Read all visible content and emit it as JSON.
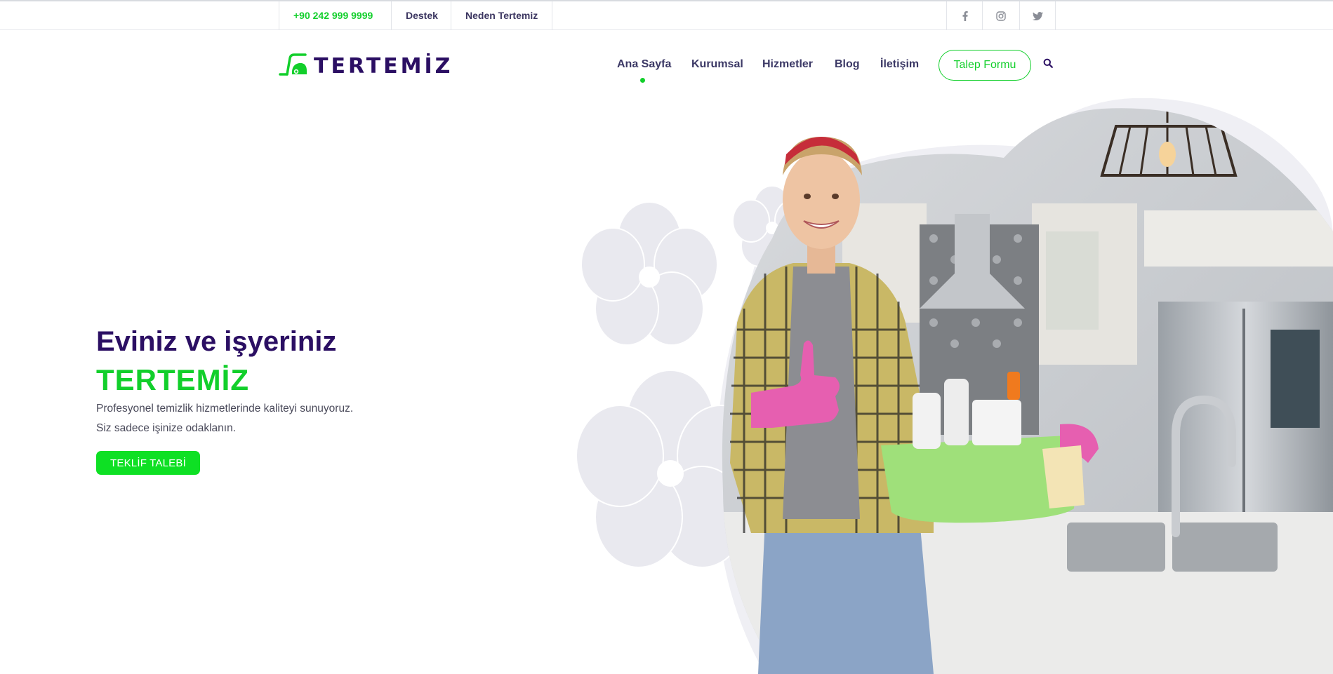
{
  "topbar": {
    "phone": "+90 242 999 9999",
    "links": [
      "Destek",
      "Neden Tertemiz"
    ],
    "social_icons": [
      "facebook-icon",
      "instagram-icon",
      "twitter-icon"
    ]
  },
  "brand": {
    "logo_text": "TERTEMİZ",
    "logo_icon": "vacuum-cleaner-icon",
    "colors": {
      "primary_purple": "#2b0f63",
      "accent_green": "#12cf2b",
      "button_green": "#0ee024"
    }
  },
  "nav": {
    "items": [
      "Ana Sayfa",
      "Kurumsal",
      "Hizmetler",
      "Blog",
      "İletişim"
    ],
    "active": "Ana Sayfa",
    "cta_label": "Talep Formu",
    "search_icon": "search-icon"
  },
  "hero": {
    "title_line1": "Eviniz ve işyeriniz",
    "title_line2": "TERTEMİZ",
    "text_line1": "Profesyonel temizlik hizmetlerinde kaliteyi sunuyoruz.",
    "text_line2": "Siz sadece işinize odaklanın.",
    "button_label": "TEKLİF TALEBİ"
  }
}
